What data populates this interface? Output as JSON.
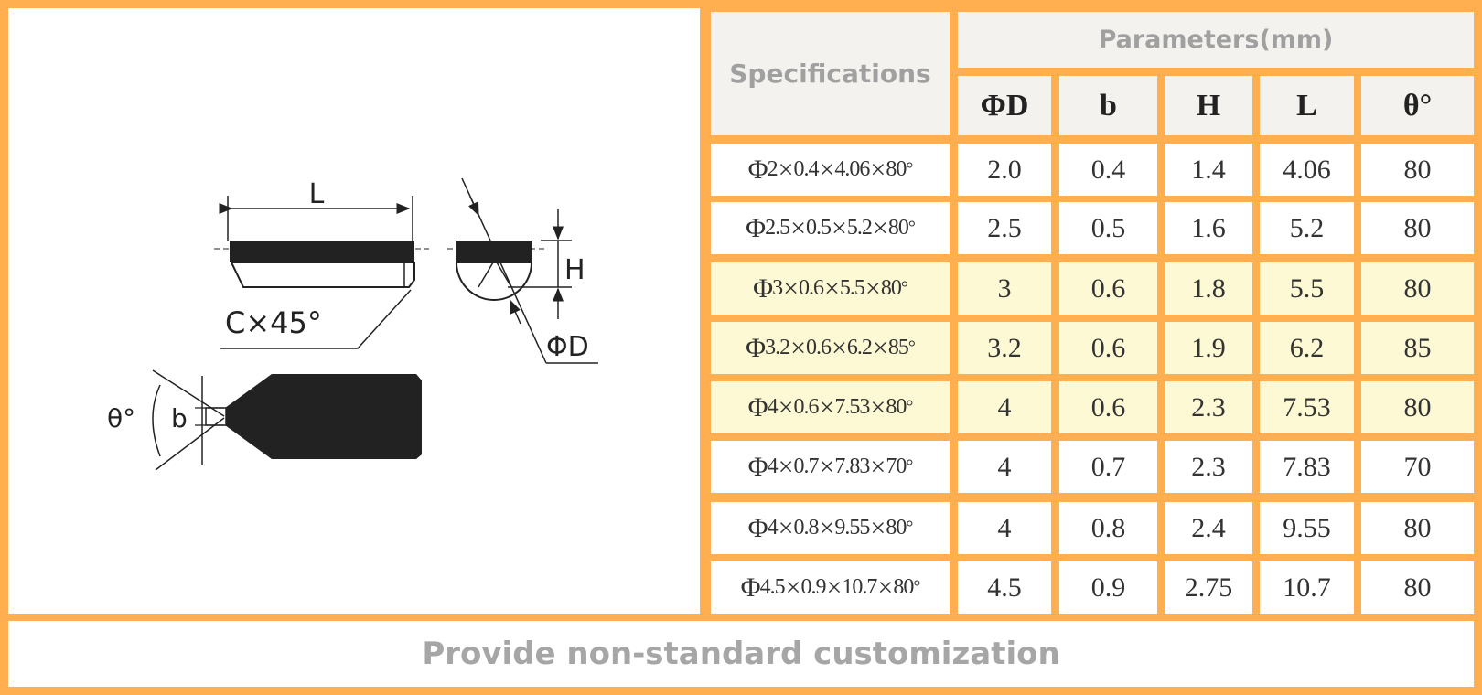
{
  "colors": {
    "border": "#ffae50",
    "header_bg": "#f3f2ee",
    "header_text": "#a0a0a0",
    "row_white": "#ffffff",
    "row_yellow": "#fdf9d4",
    "drawing_fill": "#222222"
  },
  "drawing": {
    "label_L": "L",
    "label_chamfer": "C×45°",
    "label_H": "H",
    "label_D": "ΦD",
    "label_theta": "θ°",
    "label_b": "b"
  },
  "table": {
    "header_specifications": "Specifications",
    "header_parameters": "Parameters(mm)",
    "columns": [
      "ΦD",
      "b",
      "H",
      "L",
      "θ°"
    ],
    "rows": [
      {
        "spec": {
          "d": "2",
          "b": "0.4",
          "l": "4.06",
          "t": "80"
        },
        "values": [
          "2.0",
          "0.4",
          "1.4",
          "4.06",
          "80"
        ],
        "highlight": false
      },
      {
        "spec": {
          "d": "2.5",
          "b": "0.5",
          "l": "5.2",
          "t": "80"
        },
        "values": [
          "2.5",
          "0.5",
          "1.6",
          "5.2",
          "80"
        ],
        "highlight": false
      },
      {
        "spec": {
          "d": "3",
          "b": "0.6",
          "l": "5.5",
          "t": "80"
        },
        "values": [
          "3",
          "0.6",
          "1.8",
          "5.5",
          "80"
        ],
        "highlight": true
      },
      {
        "spec": {
          "d": "3.2",
          "b": "0.6",
          "l": "6.2",
          "t": "85"
        },
        "values": [
          "3.2",
          "0.6",
          "1.9",
          "6.2",
          "85"
        ],
        "highlight": true
      },
      {
        "spec": {
          "d": "4",
          "b": "0.6",
          "l": "7.53",
          "t": "80"
        },
        "values": [
          "4",
          "0.6",
          "2.3",
          "7.53",
          "80"
        ],
        "highlight": true
      },
      {
        "spec": {
          "d": "4",
          "b": "0.7",
          "l": "7.83",
          "t": "70"
        },
        "values": [
          "4",
          "0.7",
          "2.3",
          "7.83",
          "70"
        ],
        "highlight": false
      },
      {
        "spec": {
          "d": "4",
          "b": "0.8",
          "l": "9.55",
          "t": "80"
        },
        "values": [
          "4",
          "0.8",
          "2.4",
          "9.55",
          "80"
        ],
        "highlight": false
      },
      {
        "spec": {
          "d": "4.5",
          "b": "0.9",
          "l": "10.7",
          "t": "80"
        },
        "values": [
          "4.5",
          "0.9",
          "2.75",
          "10.7",
          "80"
        ],
        "highlight": false
      }
    ],
    "spec_symbols": {
      "phi": "Φ",
      "times": "×",
      "degree": "°"
    }
  },
  "footer": {
    "text": "Provide non-standard customization"
  }
}
